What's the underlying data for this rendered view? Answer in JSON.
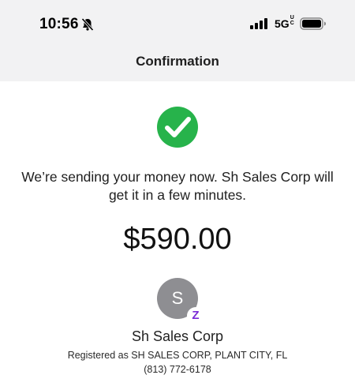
{
  "status_bar": {
    "time": "10:56",
    "bell_icon": "bell-slash-icon",
    "signal_icon": "cellular-signal-icon",
    "network": "5G",
    "network_suffix": "UC",
    "battery_icon": "battery-icon"
  },
  "nav": {
    "title": "Confirmation"
  },
  "confirmation": {
    "status_icon": "checkmark-circle-icon",
    "status_color": "#27b34b",
    "message": "We’re sending your money now. Sh Sales Corp will get it in a few minutes.",
    "amount": "$590.00"
  },
  "recipient": {
    "initial": "S",
    "avatar_color": "#8e8e92",
    "badge_icon": "zelle-icon",
    "badge_glyph": "Z",
    "badge_color": "#7a2cd6",
    "name": "Sh Sales Corp",
    "registered": "Registered as SH SALES CORP, PLANT CITY, FL",
    "phone": "(813) 772-6178"
  }
}
